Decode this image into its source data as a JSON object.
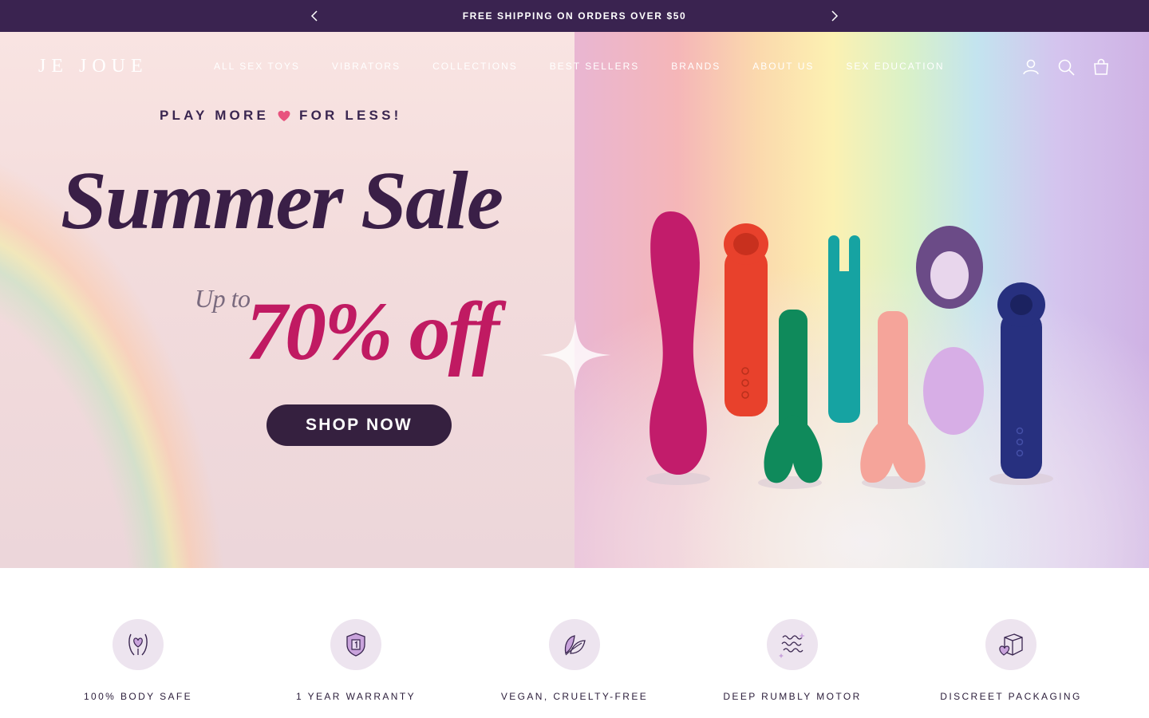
{
  "announcement": {
    "message": "FREE SHIPPING ON ORDERS OVER $50",
    "prev_icon": "chevron-left-icon",
    "next_icon": "chevron-right-icon"
  },
  "header": {
    "logo": "JE JOUE",
    "nav": [
      {
        "label": "ALL SEX TOYS"
      },
      {
        "label": "VIBRATORS"
      },
      {
        "label": "COLLECTIONS"
      },
      {
        "label": "BEST SELLERS"
      },
      {
        "label": "BRANDS"
      },
      {
        "label": "ABOUT US"
      },
      {
        "label": "SEX EDUCATION"
      }
    ],
    "icons": [
      "account-icon",
      "search-icon",
      "cart-icon"
    ]
  },
  "hero": {
    "tagline_part1": "PLAY MORE",
    "tagline_part2": "FOR LESS!",
    "headline": "Summer Sale",
    "upto": "Up to",
    "discount": "70% off",
    "cta": "SHOP NOW"
  },
  "features": [
    {
      "label": "100% BODY SAFE",
      "icon": "body-heart-icon"
    },
    {
      "label": "1 YEAR WARRANTY",
      "icon": "shield-one-icon"
    },
    {
      "label": "VEGAN, CRUELTY-FREE",
      "icon": "leaf-icon"
    },
    {
      "label": "DEEP RUMBLY MOTOR",
      "icon": "vibration-waves-icon"
    },
    {
      "label": "DISCREET PACKAGING",
      "icon": "box-heart-icon"
    }
  ],
  "colors": {
    "announcement_bg": "#3a2350",
    "headline": "#3a1f47",
    "discount": "#c01a62",
    "cta_bg": "#35203f",
    "feature_circle": "#ede4ef"
  }
}
